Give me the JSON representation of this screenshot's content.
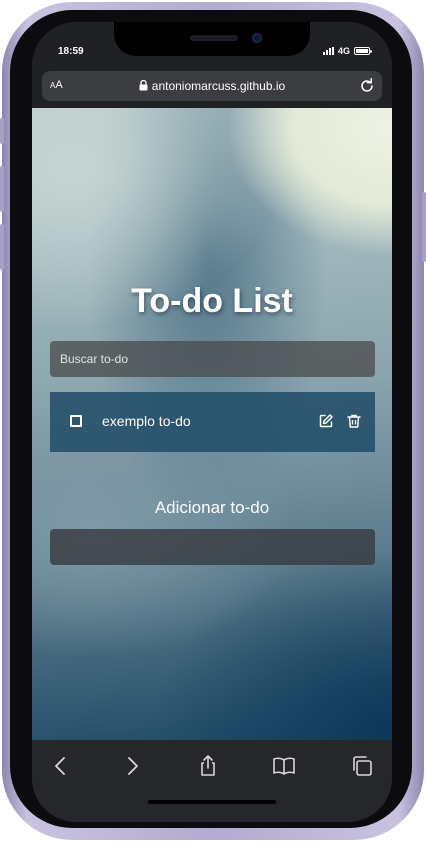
{
  "status_bar": {
    "time": "18:59",
    "network": "4G"
  },
  "browser": {
    "text_size_label": "AA",
    "url": "antoniomarcuss.github.io"
  },
  "app": {
    "title": "To-do List",
    "search": {
      "placeholder": "Buscar to-do",
      "value": ""
    },
    "todos": [
      {
        "label": "exemplo to-do",
        "done": false
      }
    ],
    "add_section_title": "Adicionar to-do",
    "add_input": {
      "value": ""
    }
  },
  "icons": {
    "lock": "lock-icon",
    "reload": "reload-icon",
    "edit": "edit-icon",
    "delete": "trash-icon",
    "back": "chevron-left-icon",
    "forward": "chevron-right-icon",
    "share": "share-icon",
    "bookmarks": "book-icon",
    "tabs": "tabs-icon"
  },
  "colors": {
    "todo_background": "#1c4864",
    "frame": "#b3abd0"
  }
}
